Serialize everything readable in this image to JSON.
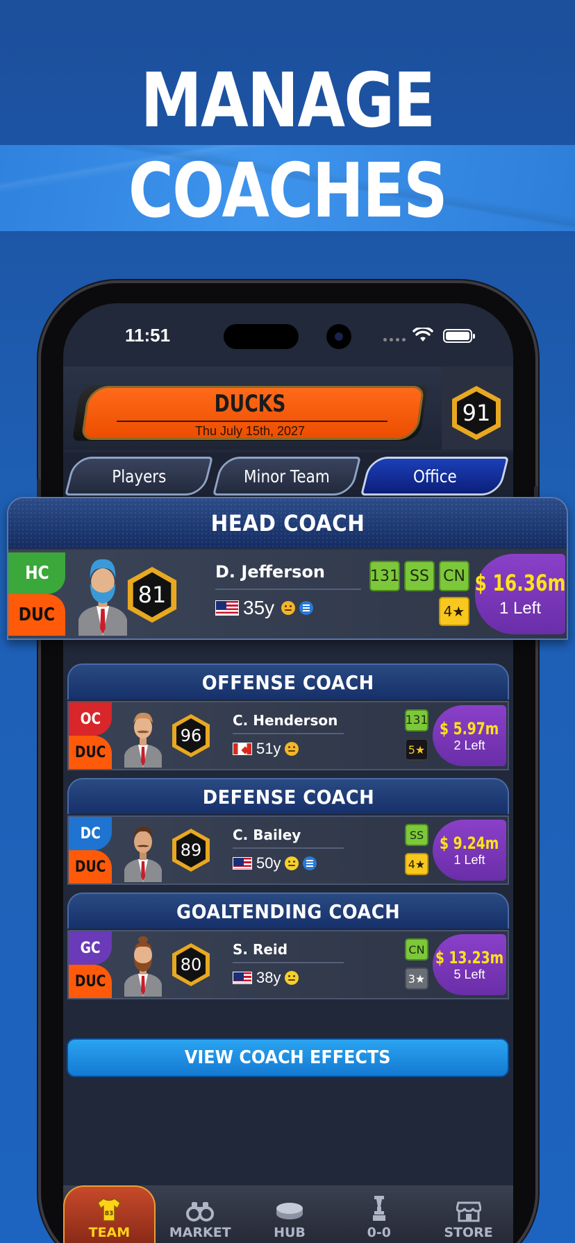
{
  "headline": {
    "line1": "MANAGE",
    "line2": "COACHES"
  },
  "status_bar": {
    "time": "11:51"
  },
  "team": {
    "name": "DUCKS",
    "date": "Thu July 15th, 2027",
    "overall": "91"
  },
  "tabs": [
    {
      "label": "Players",
      "active": false
    },
    {
      "label": "Minor Team",
      "active": false
    },
    {
      "label": "Office",
      "active": true
    }
  ],
  "head_coach": {
    "section_title": "HEAD COACH",
    "role": "HC",
    "team_tag": "DUC",
    "rating": "81",
    "name": "D. Jefferson",
    "age": "35y",
    "badges": [
      "131",
      "SS",
      "CN"
    ],
    "stars": "4★",
    "salary": "$ 16.36m",
    "years_left": "1 Left"
  },
  "coaches": [
    {
      "section_title": "OFFENSE COACH",
      "role": "OC",
      "team_tag": "DUC",
      "rating": "96",
      "name": "C. Henderson",
      "age": "51y",
      "badge": "131",
      "stars": "5★",
      "salary": "$ 5.97m",
      "years_left": "2 Left"
    },
    {
      "section_title": "DEFENSE COACH",
      "role": "DC",
      "team_tag": "DUC",
      "rating": "89",
      "name": "C. Bailey",
      "age": "50y",
      "badge": "SS",
      "stars": "4★",
      "salary": "$ 9.24m",
      "years_left": "1 Left"
    },
    {
      "section_title": "GOALTENDING COACH",
      "role": "GC",
      "team_tag": "DUC",
      "rating": "80",
      "name": "S. Reid",
      "age": "38y",
      "badge": "CN",
      "stars": "3★",
      "salary": "$ 13.23m",
      "years_left": "5 Left"
    }
  ],
  "effects_button": "VIEW COACH EFFECTS",
  "nav": [
    {
      "label": "TEAM",
      "icon": "jersey-icon",
      "jersey_number": "83",
      "active": true
    },
    {
      "label": "MARKET",
      "icon": "binoculars-icon",
      "active": false
    },
    {
      "label": "HUB",
      "icon": "puck-icon",
      "active": false
    },
    {
      "label": "0-0",
      "icon": "trophy-icon",
      "active": false
    },
    {
      "label": "STORE",
      "icon": "store-icon",
      "active": false
    }
  ],
  "colors": {
    "background": "#1e5fb4",
    "stripe": "#3a90e8",
    "team_orange": "#f25a0c",
    "salary_purple": "#7a36b8",
    "salary_text": "#ffe21a",
    "badge_green": "#7cc83a",
    "badge_yellow": "#f8c81e",
    "hc_green": "#3aa83a",
    "oc_red": "#d8262a",
    "dc_blue": "#1e74d0",
    "gc_purple": "#6a3ab8",
    "button_blue": "#1e8fe0"
  }
}
